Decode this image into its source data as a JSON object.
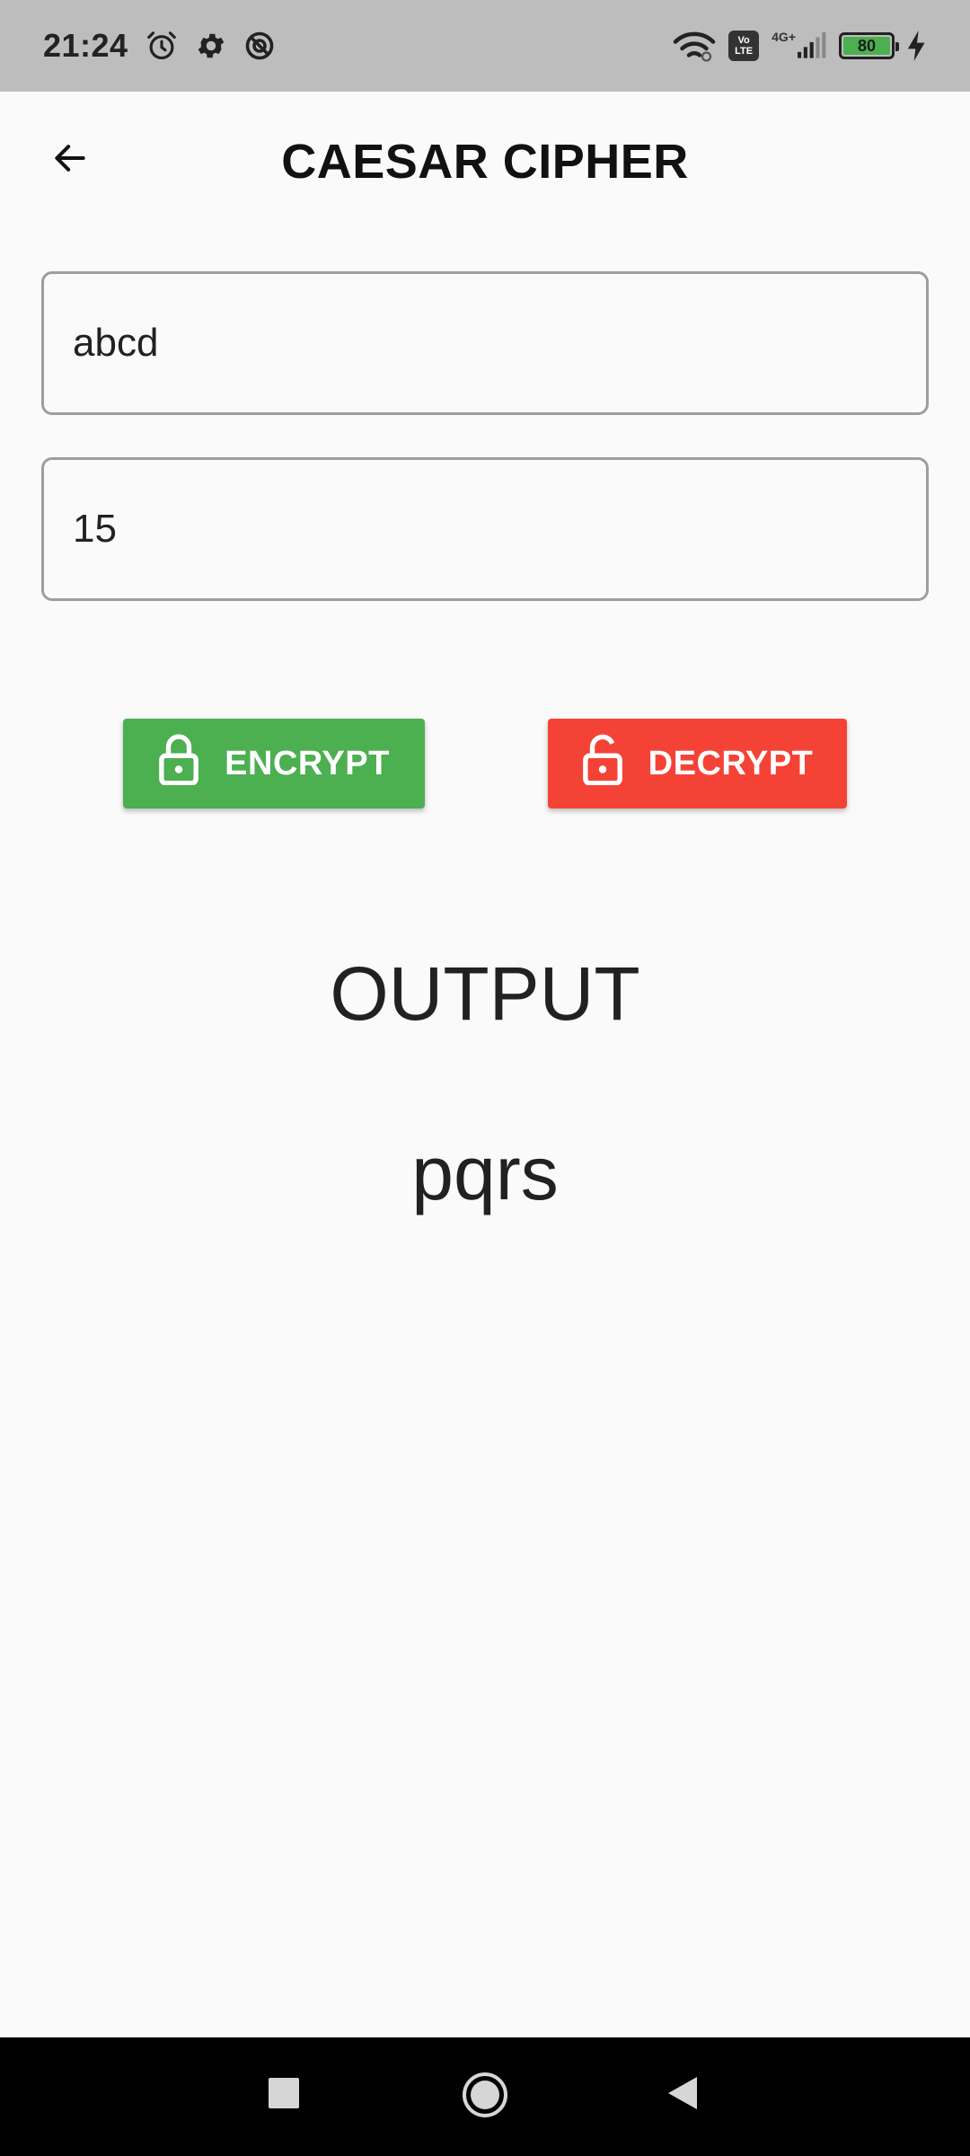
{
  "status_bar": {
    "time": "21:24",
    "volte_top": "Vo",
    "volte_bottom": "LTE",
    "network_type": "4G+",
    "battery_level": "80"
  },
  "app_bar": {
    "title": "CAESAR CIPHER"
  },
  "inputs": {
    "text_value": "abcd",
    "shift_value": "15"
  },
  "buttons": {
    "encrypt_label": "ENCRYPT",
    "decrypt_label": "DECRYPT"
  },
  "output": {
    "label": "OUTPUT",
    "value": "pqrs"
  },
  "colors": {
    "encrypt": "#4caf50",
    "decrypt": "#f44336",
    "status_bar": "#bdbdbd",
    "background": "#fafafa"
  }
}
